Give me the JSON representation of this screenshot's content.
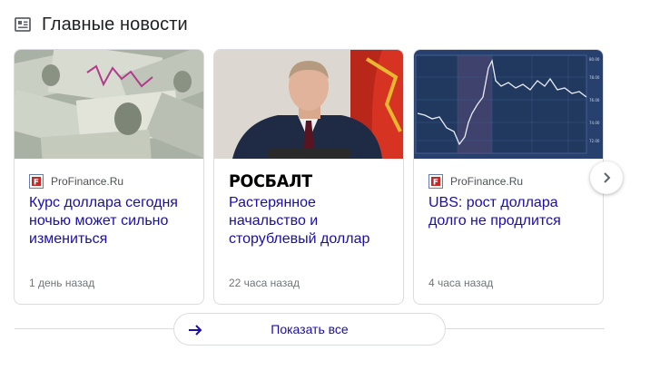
{
  "header": {
    "title": "Главные новости",
    "icon": "news-icon"
  },
  "cards": [
    {
      "image": "dollar-bills-with-chart",
      "source": "ProFinance.Ru",
      "favicon_color": "#c62828",
      "headline": "Курс доллара сегодня ночью может сильно измениться",
      "time": "1 день назад"
    },
    {
      "image": "man-at-desk-with-flag",
      "source": "РОСБАЛТ",
      "headline": "Растерянное начальство и сторублевый доллар",
      "time": "22 часа назад"
    },
    {
      "image": "price-chart",
      "source": "ProFinance.Ru",
      "favicon_color": "#c62828",
      "headline": "UBS: рост доллара долго не продлится",
      "time": "4 часа назад"
    }
  ],
  "controls": {
    "show_all_label": "Показать все",
    "next_icon": "chevron-right-icon",
    "arrow_icon": "arrow-right-icon"
  },
  "colors": {
    "link": "#1a0dab",
    "meta": "#70757a",
    "border": "#dadce0"
  }
}
